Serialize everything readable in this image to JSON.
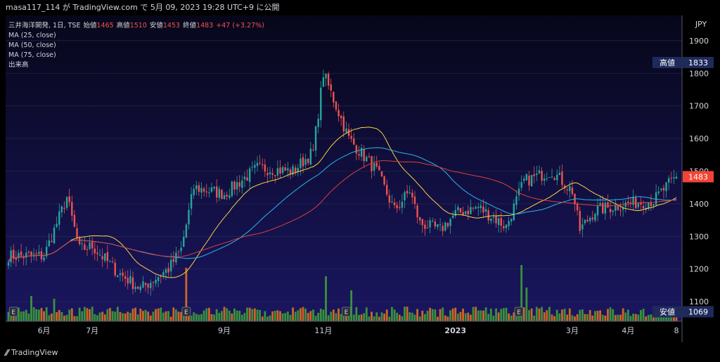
{
  "header": {
    "publisher_line": "masa117_114 が TradingView.com で 5月 09, 2023 19:28 UTC+9 に公開"
  },
  "legend": {
    "symbol": "三井海洋開発, 1日, TSE",
    "open_label": "始値",
    "open_value": "1465",
    "high_label": "高値",
    "high_value": "1510",
    "low_label": "安値",
    "low_value": "1453",
    "close_label": "終値",
    "close_value": "1483",
    "change": "+47 (+3.27%)",
    "ma25": "MA (25, close)",
    "ma50": "MA (50, close)",
    "ma75": "MA (75, close)",
    "volume": "出来高"
  },
  "price_tags": {
    "high_label": "高値",
    "high_value": "1833",
    "low_label": "安値",
    "low_value": "1069",
    "last_value": "1483"
  },
  "footer": {
    "brand": "TradingView"
  },
  "earnings_marker": "E",
  "colors": {
    "up": "#26a69a",
    "down": "#ef5350",
    "ma25": "#f5d142",
    "ma50": "#2bb6e8",
    "ma75": "#d9413a",
    "vol_up": "#3e9f3a",
    "vol_down": "#e0701e",
    "text": "#d1d4dc",
    "tag_bg": "#1f2a5c",
    "last_bg": "#f44336"
  },
  "chart_data": {
    "type": "candlestick",
    "currency": "JPY",
    "y_ticks": [
      1100,
      1200,
      1300,
      1400,
      1500,
      1600,
      1700,
      1800,
      1900
    ],
    "ylim": [
      1040,
      1960
    ],
    "x_tick_labels": [
      "6月",
      "7月",
      "9月",
      "11月",
      "2023",
      "3月",
      "4月",
      "8"
    ],
    "month_anchors": [
      {
        "label": "",
        "day": 0,
        "price": 1240
      },
      {
        "label": "6月",
        "day": 14,
        "price": 1240
      },
      {
        "label": "",
        "day": 23,
        "price": 1420
      },
      {
        "label": "",
        "day": 28,
        "price": 1260
      },
      {
        "label": "7月",
        "day": 33,
        "price": 1270
      },
      {
        "label": "",
        "day": 43,
        "price": 1190
      },
      {
        "label": "",
        "day": 52,
        "price": 1140
      },
      {
        "label": "",
        "day": 63,
        "price": 1200
      },
      {
        "label": "",
        "day": 68,
        "price": 1260
      },
      {
        "label": "",
        "day": 73,
        "price": 1450
      },
      {
        "label": "9月",
        "day": 85,
        "price": 1430
      },
      {
        "label": "",
        "day": 98,
        "price": 1510
      },
      {
        "label": "",
        "day": 112,
        "price": 1500
      },
      {
        "label": "",
        "day": 120,
        "price": 1560
      },
      {
        "label": "11月",
        "day": 124,
        "price": 1800
      },
      {
        "label": "",
        "day": 127,
        "price": 1740
      },
      {
        "label": "",
        "day": 134,
        "price": 1600
      },
      {
        "label": "",
        "day": 145,
        "price": 1500
      },
      {
        "label": "",
        "day": 152,
        "price": 1380
      },
      {
        "label": "",
        "day": 158,
        "price": 1440
      },
      {
        "label": "",
        "day": 162,
        "price": 1340
      },
      {
        "label": "",
        "day": 170,
        "price": 1320
      },
      {
        "label": "2023",
        "day": 176,
        "price": 1370
      },
      {
        "label": "",
        "day": 185,
        "price": 1390
      },
      {
        "label": "",
        "day": 196,
        "price": 1330
      },
      {
        "label": "",
        "day": 203,
        "price": 1470
      },
      {
        "label": "",
        "day": 214,
        "price": 1500
      },
      {
        "label": "3月",
        "day": 222,
        "price": 1440
      },
      {
        "label": "",
        "day": 225,
        "price": 1320
      },
      {
        "label": "",
        "day": 231,
        "price": 1380
      },
      {
        "label": "4月",
        "day": 244,
        "price": 1400
      },
      {
        "label": "",
        "day": 254,
        "price": 1410
      },
      {
        "label": "",
        "day": 260,
        "price": 1460
      },
      {
        "label": "8",
        "day": 263,
        "price": 1483
      }
    ],
    "volume_spikes": [
      {
        "day": 70,
        "level": 0.95
      },
      {
        "day": 125,
        "level": 0.8
      },
      {
        "day": 135,
        "level": 0.55
      },
      {
        "day": 202,
        "level": 1.0
      },
      {
        "day": 204,
        "level": 0.6
      },
      {
        "day": 9,
        "level": 0.45
      },
      {
        "day": 18,
        "level": 0.4
      }
    ],
    "earnings_days": [
      2,
      70,
      133,
      201,
      263
    ]
  }
}
